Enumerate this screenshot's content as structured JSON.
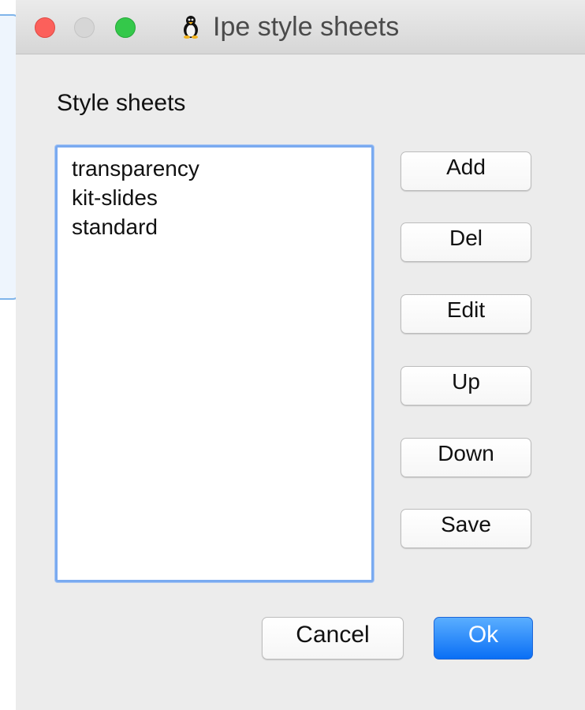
{
  "window": {
    "title": "Ipe style sheets"
  },
  "section": {
    "label": "Style sheets"
  },
  "style_sheets": [
    "transparency",
    "kit-slides",
    "standard"
  ],
  "side_buttons": {
    "add": "Add",
    "del": "Del",
    "edit": "Edit",
    "up": "Up",
    "down": "Down",
    "save": "Save"
  },
  "footer": {
    "cancel": "Cancel",
    "ok": "Ok"
  },
  "icons": {
    "app": "penguin-icon",
    "close": "close-icon",
    "minimize": "minimize-icon",
    "zoom": "zoom-icon"
  },
  "colors": {
    "accent": "#0a6ff5",
    "focus_ring": "#7aaaf0",
    "close": "#fc605b",
    "zoom": "#34c84a"
  }
}
